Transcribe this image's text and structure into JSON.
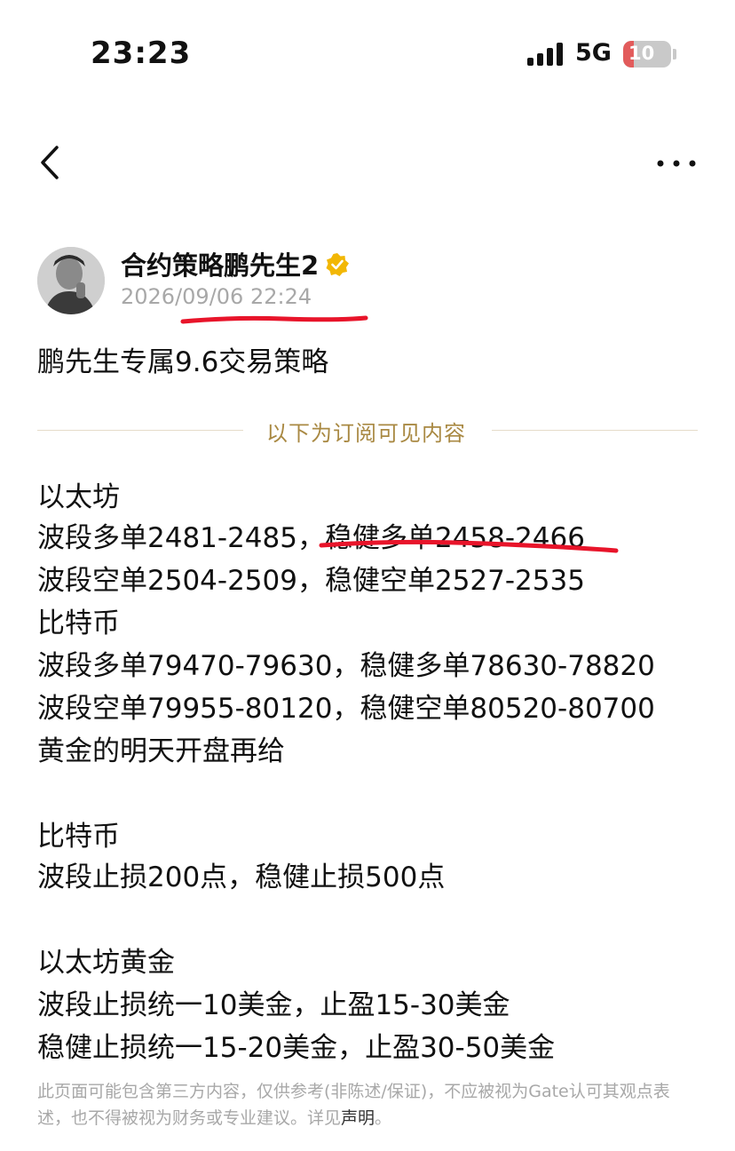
{
  "status_bar": {
    "time": "23:23",
    "network": "5G",
    "battery": "10",
    "battery_level_percent": 10,
    "battery_color": "#e25b5b"
  },
  "nav": {
    "back_icon": "chevron-left-icon",
    "more_icon": "more-horizontal-icon"
  },
  "post": {
    "author": "合约策略鹏先生2",
    "verified_icon": "verified-badge-icon",
    "verified_color": "#f2b705",
    "timestamp": "2026/09/06 22:24",
    "title": "鹏先生专属9.6交易策略"
  },
  "paywall_divider": "以下为订阅可见内容",
  "content": {
    "lines": [
      "以太坊",
      "波段多单2481-2485，",
      "稳健多单2458-2466",
      "波段空单2504-2509，稳健空单2527-2535",
      "比特币",
      "波段多单79470-79630，稳健多单78630-78820",
      "波段空单79955-80120，稳健空单80520-80700",
      "黄金的明天开盘再给",
      "比特币",
      "波段止损200点，稳健止损500点",
      "以太坊黄金",
      "波段止损统一10美金，止盈15-30美金",
      "稳健止损统一15-20美金，止盈30-50美金"
    ]
  },
  "disclaimer": {
    "text": "此页面可能包含第三方内容，仅供参考(非陈述/保证)，不应被视为Gate认可其观点表述，也不得被视为财务或专业建议。详见",
    "link": "声明",
    "end": "。"
  },
  "colors": {
    "annotation_red": "#e8142a",
    "divider_gold": "#a98943",
    "muted_gray": "#a8a8a8"
  }
}
